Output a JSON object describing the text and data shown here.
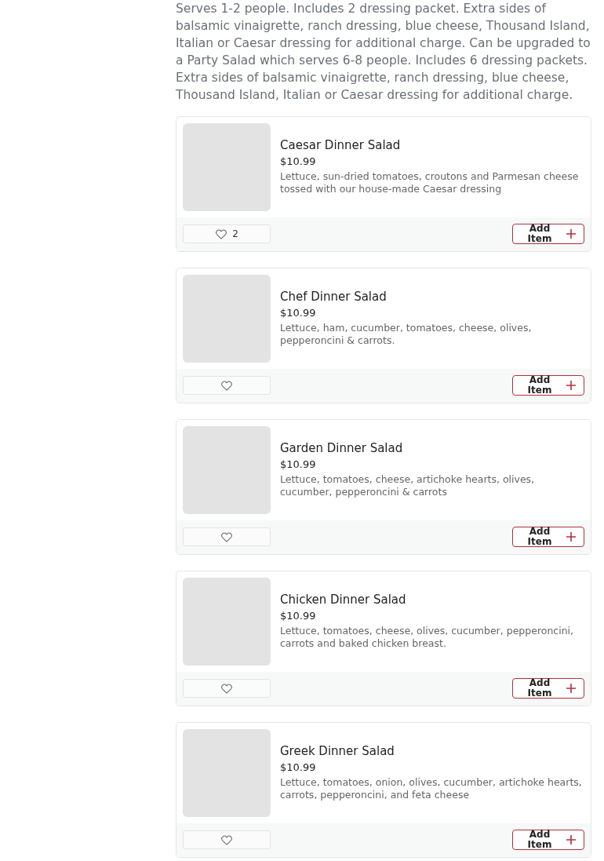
{
  "category_description": "Serves 1-2 people. Includes 2 dressing packet. Extra sides of balsamic vinaigrette, ranch dressing, blue cheese, Thousand Island, Italian or Caesar dressing for additional charge. Can be upgraded to a Party Salad which serves 6-8 people. Includes 6 dressing packets. Extra sides of balsamic vinaigrette, ranch dressing, blue cheese, Thousand Island, Italian or Caesar dressing for additional charge.",
  "items": [
    {
      "name": "Caesar Dinner Salad",
      "price": "$10.99",
      "description": "Lettuce, sun-dried tomatoes, croutons and Parmesan cheese tossed with our house-made Caesar dressing",
      "likes": "2",
      "button": "Add Item"
    },
    {
      "name": "Chef Dinner Salad",
      "price": "$10.99",
      "description": "Lettuce, ham, cucumber, tomatoes, cheese, olives, pepperoncini & carrots.",
      "button": "Add Item"
    },
    {
      "name": "Garden Dinner Salad",
      "price": "$10.99",
      "description": "Lettuce, tomatoes, cheese, artichoke hearts, olives, cucumber, pepperoncini & carrots",
      "button": "Add Item"
    },
    {
      "name": "Chicken Dinner Salad",
      "price": "$10.99",
      "description": "Lettuce, tomatoes, cheese, olives, cucumber, pepperoncini, carrots and baked chicken breast.",
      "button": "Add Item"
    },
    {
      "name": "Greek Dinner Salad",
      "price": "$10.99",
      "description": "Lettuce, tomatoes, onion, olives, cucumber, artichoke hearts, carrots, pepperoncini, and feta cheese",
      "button": "Add Item"
    }
  ]
}
